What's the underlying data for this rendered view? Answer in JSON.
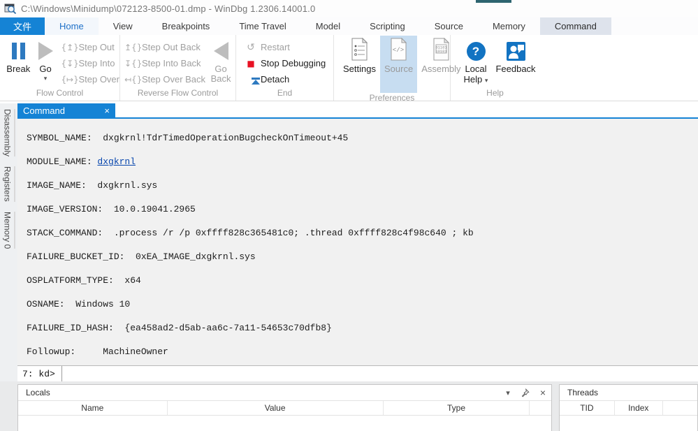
{
  "window": {
    "title": "C:\\Windows\\Minidump\\072123-8500-01.dmp - WinDbg 1.2306.14001.0"
  },
  "ribbon": {
    "tabs": [
      {
        "id": "file",
        "label": "文件",
        "style": "file"
      },
      {
        "id": "home",
        "label": "Home",
        "style": "active"
      },
      {
        "id": "view",
        "label": "View"
      },
      {
        "id": "breakpoints",
        "label": "Breakpoints"
      },
      {
        "id": "time-travel",
        "label": "Time Travel"
      },
      {
        "id": "model",
        "label": "Model"
      },
      {
        "id": "scripting",
        "label": "Scripting"
      },
      {
        "id": "source",
        "label": "Source"
      },
      {
        "id": "memory",
        "label": "Memory"
      },
      {
        "id": "command",
        "label": "Command",
        "style": "highlighted"
      }
    ],
    "flow_control": {
      "group_label": "Flow Control",
      "break_label": "Break",
      "go_label": "Go",
      "step_out": "Step Out",
      "step_into": "Step Into",
      "step_over": "Step Over"
    },
    "reverse_flow_control": {
      "group_label": "Reverse Flow Control",
      "step_out_back": "Step Out Back",
      "step_into_back": "Step Into Back",
      "step_over_back": "Step Over Back",
      "go_back_line1": "Go",
      "go_back_line2": "Back"
    },
    "end": {
      "group_label": "End",
      "restart": "Restart",
      "stop_debugging": "Stop Debugging",
      "detach": "Detach"
    },
    "preferences": {
      "group_label": "Preferences",
      "settings": "Settings",
      "source": "Source",
      "assembly": "Assembly"
    },
    "help": {
      "group_label": "Help",
      "local_help_line1": "Local",
      "local_help_line2": "Help",
      "feedback": "Feedback"
    }
  },
  "sidebar": {
    "tabs": [
      {
        "id": "disassembly",
        "label": "Disassembly"
      },
      {
        "id": "registers",
        "label": "Registers"
      },
      {
        "id": "memory-0",
        "label": "Memory 0"
      }
    ]
  },
  "command_panel": {
    "tab_label": "Command",
    "output_lines": [
      {
        "text": "SYMBOL_NAME:  dxgkrnl!TdrTimedOperationBugcheckOnTimeout+45"
      },
      {
        "prefix": "MODULE_NAME: ",
        "link": "dxgkrnl"
      },
      {
        "text": "IMAGE_NAME:  dxgkrnl.sys"
      },
      {
        "text": "IMAGE_VERSION:  10.0.19041.2965"
      },
      {
        "text": "STACK_COMMAND:  .process /r /p 0xffff828c365481c0; .thread 0xffff828c4f98c640 ; kb"
      },
      {
        "text": "FAILURE_BUCKET_ID:  0xEA_IMAGE_dxgkrnl.sys"
      },
      {
        "text": "OSPLATFORM_TYPE:  x64"
      },
      {
        "text": "OSNAME:  Windows 10"
      },
      {
        "text": "FAILURE_ID_HASH:  {ea458ad2-d5ab-aa6c-7a11-54653c70dfb8}"
      },
      {
        "text": "Followup:     MachineOwner"
      }
    ],
    "prompt": "7: kd>",
    "input_value": ""
  },
  "locals_panel": {
    "title": "Locals",
    "columns": [
      "Name",
      "Value",
      "Type"
    ]
  },
  "threads_panel": {
    "title": "Threads",
    "columns": [
      "TID",
      "Index"
    ]
  },
  "icons": {
    "step_out": "{↥}",
    "step_into": "{↧}",
    "step_over": "{↦}",
    "step_out_back": "↥{}",
    "step_into_back": "↧{}",
    "step_over_back": "↤{}",
    "restart": "↺",
    "stop": "■",
    "dropdown": "▾",
    "close": "×",
    "help_question": "?"
  },
  "colors": {
    "accent_blue": "#1583d5",
    "stop_red": "#e81123",
    "link_blue": "#0645ad",
    "detach_blue": "#2e7ac0",
    "help_icon_blue": "#1273c2",
    "source_highlight": "#c7ddf1"
  }
}
